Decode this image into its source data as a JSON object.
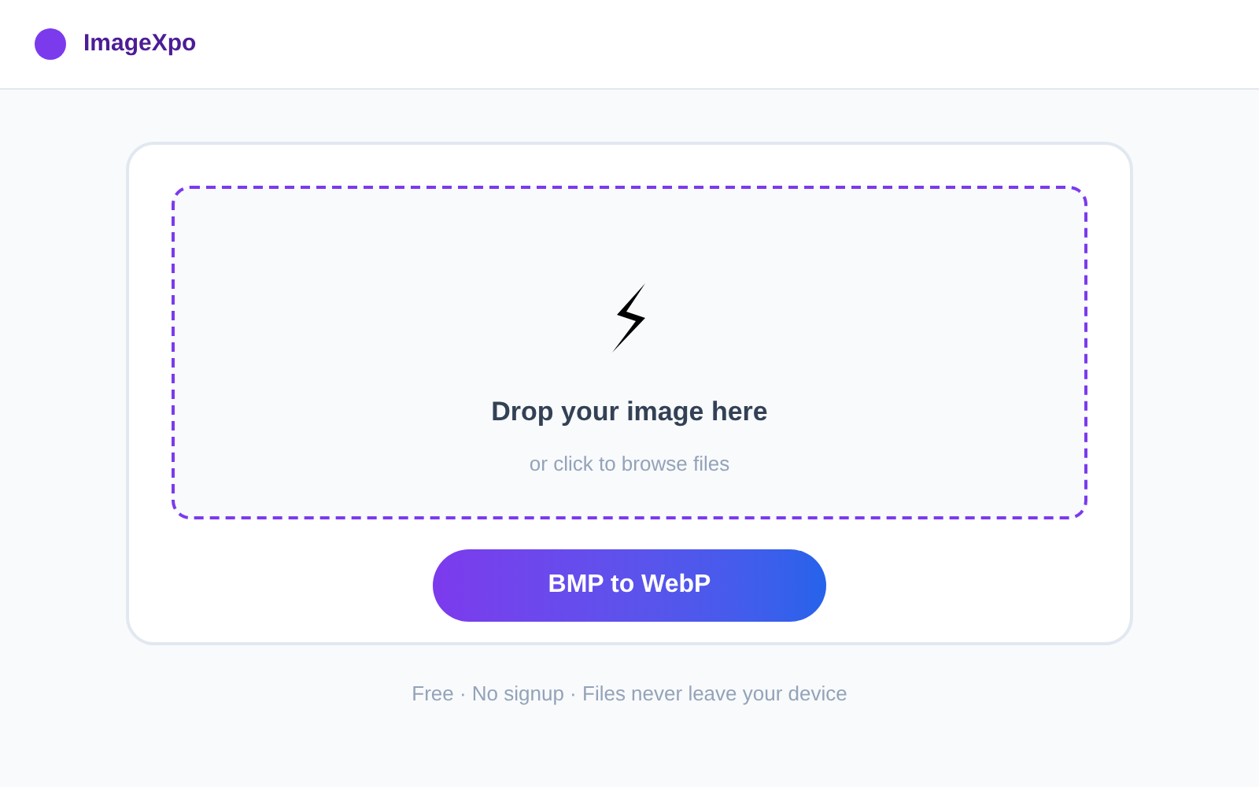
{
  "header": {
    "brand": "ImageXpo"
  },
  "dropzone": {
    "title": "Drop your image here",
    "subtitle": "or click to browse files"
  },
  "convert_button": {
    "label": "BMP to WebP"
  },
  "footer": {
    "tagline": "Free · No signup · Files never leave your device"
  }
}
